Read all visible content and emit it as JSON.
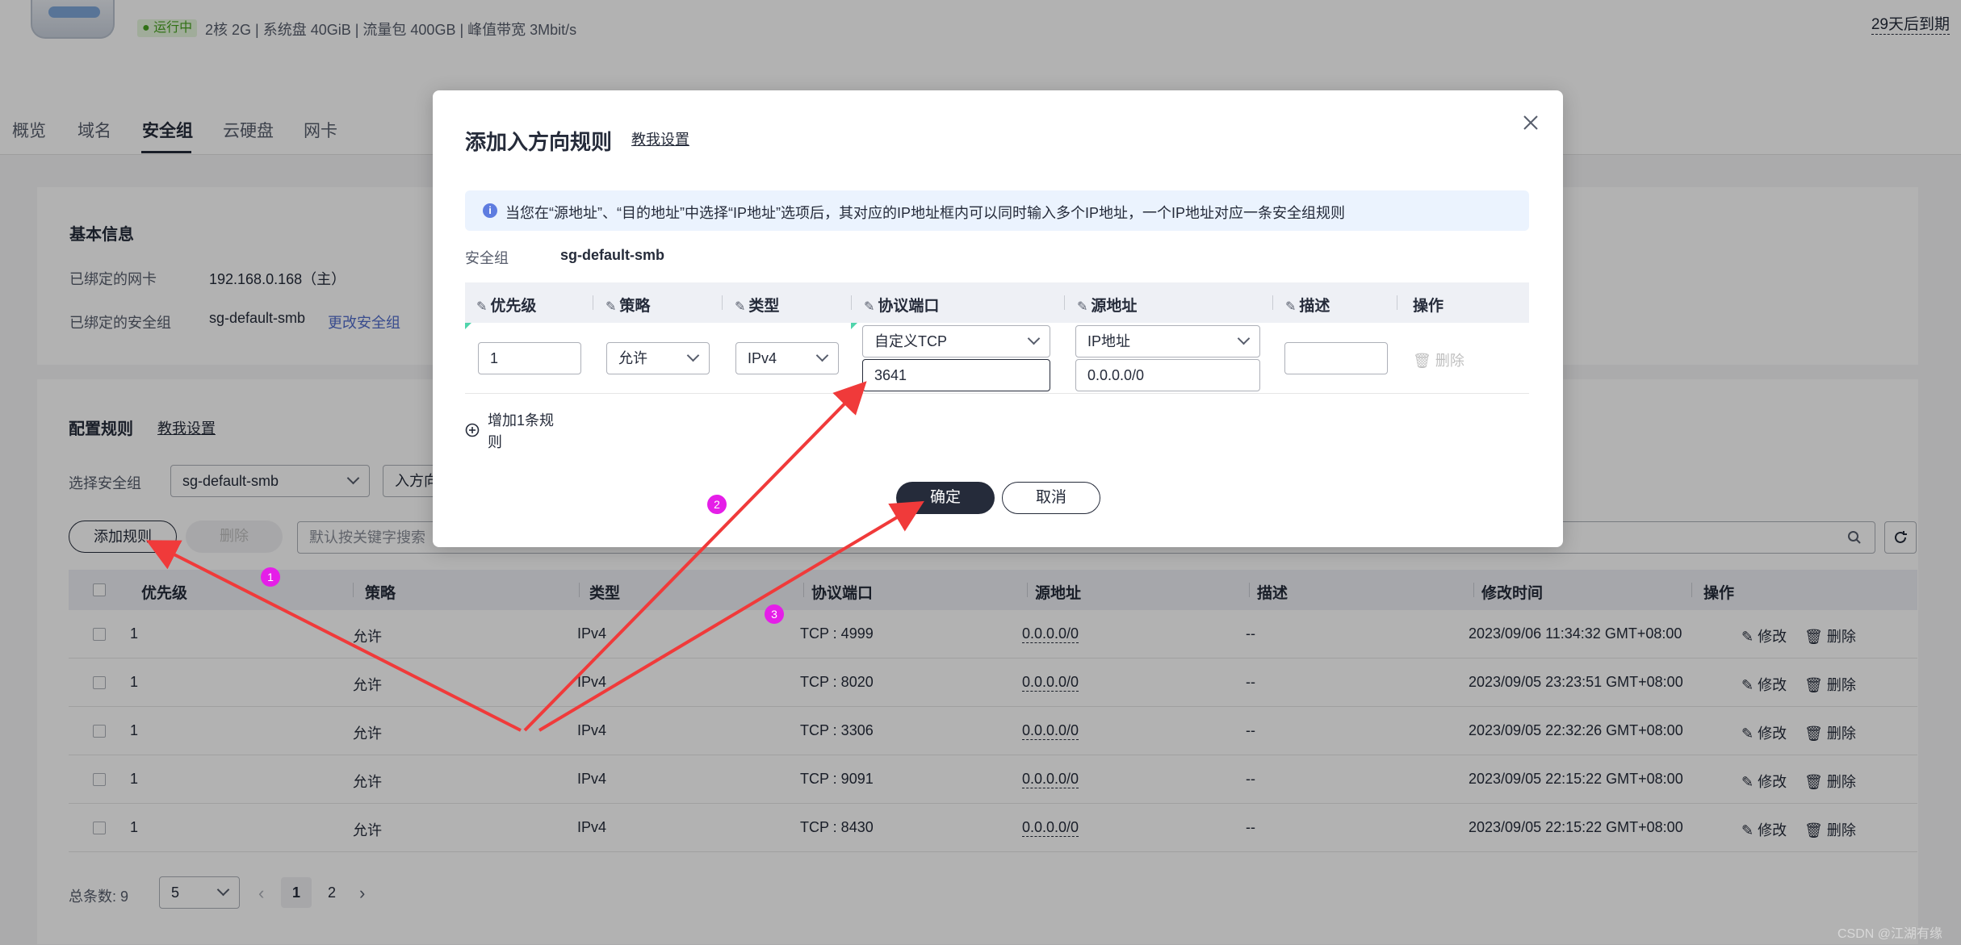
{
  "header": {
    "status": "运行中",
    "spec": "2核 2G | 系统盘 40GiB | 流量包 400GB | 峰值带宽 3Mbit/s",
    "expire": "29天后到期"
  },
  "tabs": [
    "概览",
    "域名",
    "安全组",
    "云硬盘",
    "网卡"
  ],
  "basic": {
    "title": "基本信息",
    "nic_label": "已绑定的网卡",
    "nic_value": "192.168.0.168（主）",
    "sg_label": "已绑定的安全组",
    "sg_value": "sg-default-smb",
    "change_link": "更改安全组"
  },
  "rules": {
    "title": "配置规则",
    "help": "教我设置",
    "select_label": "选择安全组",
    "select_value": "sg-default-smb",
    "direction": "入方向",
    "add_button": "添加规则",
    "delete_button": "删除",
    "search_placeholder": "默认按关键字搜索",
    "columns": [
      "优先级",
      "策略",
      "类型",
      "协议端口",
      "源地址",
      "描述",
      "修改时间",
      "操作"
    ],
    "rows": [
      {
        "priority": "1",
        "policy": "允许",
        "type": "IPv4",
        "port": "TCP : 4999",
        "source": "0.0.0.0/0",
        "desc": "--",
        "time": "2023/09/06 11:34:32 GMT+08:00"
      },
      {
        "priority": "1",
        "policy": "允许",
        "type": "IPv4",
        "port": "TCP : 8020",
        "source": "0.0.0.0/0",
        "desc": "--",
        "time": "2023/09/05 23:23:51 GMT+08:00"
      },
      {
        "priority": "1",
        "policy": "允许",
        "type": "IPv4",
        "port": "TCP : 3306",
        "source": "0.0.0.0/0",
        "desc": "--",
        "time": "2023/09/05 22:32:26 GMT+08:00"
      },
      {
        "priority": "1",
        "policy": "允许",
        "type": "IPv4",
        "port": "TCP : 9091",
        "source": "0.0.0.0/0",
        "desc": "--",
        "time": "2023/09/05 22:15:22 GMT+08:00"
      },
      {
        "priority": "1",
        "policy": "允许",
        "type": "IPv4",
        "port": "TCP : 8430",
        "source": "0.0.0.0/0",
        "desc": "--",
        "time": "2023/09/05 22:15:22 GMT+08:00"
      }
    ],
    "edit": "修改",
    "delete": "删除",
    "total_label": "总条数: 9",
    "page_size": "5",
    "pages": [
      "1",
      "2"
    ]
  },
  "dialog": {
    "title": "添加入方向规则",
    "help": "教我设置",
    "info": "当您在“源地址”、“目的地址”中选择“IP地址”选项后，其对应的IP地址框内可以同时输入多个IP地址，一个IP地址对应一条安全组规则",
    "sg_label": "安全组",
    "sg_value": "sg-default-smb",
    "columns": [
      "优先级",
      "策略",
      "类型",
      "协议端口",
      "源地址",
      "描述",
      "操作"
    ],
    "row": {
      "priority": "1",
      "policy": "允许",
      "type": "IPv4",
      "protocol": "自定义TCP",
      "port": "3641",
      "source_type": "IP地址",
      "source": "0.0.0.0/0",
      "delete": "删除"
    },
    "add_rule": "增加1条规则",
    "ok": "确定",
    "cancel": "取消"
  },
  "annotations": [
    "1",
    "2",
    "3"
  ],
  "watermark": "CSDN @江湖有缘",
  "colors": {
    "arrow": "#f03a3a",
    "step": "#e51ee8",
    "primary": "#252b3a",
    "link": "#526ecc"
  }
}
